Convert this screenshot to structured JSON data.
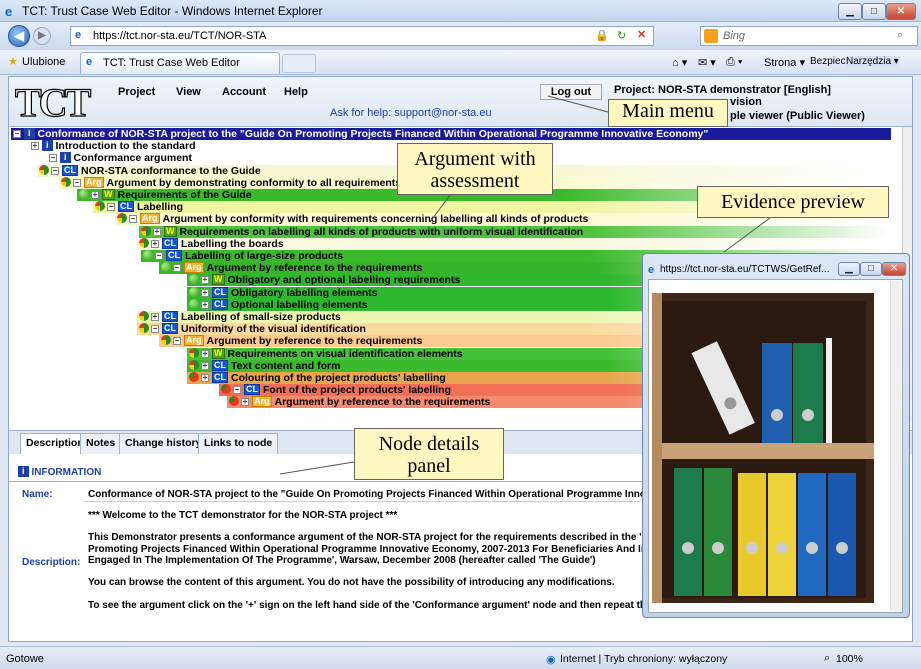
{
  "window": {
    "title": "TCT: Trust Case Web Editor - Windows Internet Explorer"
  },
  "browser": {
    "url": "https://tct.nor-sta.eu/TCT/NOR-STA",
    "search_placeholder": "Bing",
    "favorites": "Ulubione",
    "tab_title": "TCT: Trust Case Web Editor",
    "cmd_page": "Strona ▾",
    "cmd_safety": "Bezpieczeństwo ▾",
    "cmd_tools": "Narzędzia ▾"
  },
  "app": {
    "logo": "TCT",
    "menu": [
      "Project",
      "View",
      "Account",
      "Help"
    ],
    "logout": "Log out",
    "help_text": "Ask for help: support@nor-sta.eu",
    "project_line": "Project:  NOR-STA demonstrator [English]",
    "revision_fragment": "vision",
    "viewer_fragment": "ple viewer (Public Viewer)"
  },
  "tree": [
    {
      "text": "Conformance of NOR-STA project to the \"Guide On Promoting Projects Financed Within Operational Programme Innovative Economy\"",
      "icon": "I",
      "status": "none",
      "bg": "#1a1a9c",
      "fg": "#ffffff"
    },
    {
      "text": "Introduction to the standard",
      "icon": "I",
      "status": "none"
    },
    {
      "text": "Conformance argument",
      "icon": "I",
      "status": "none"
    },
    {
      "text": "NOR-STA conformance to the Guide",
      "icon": "CL",
      "status": "tri"
    },
    {
      "text": "Argument by demonstrating conformity to all requirements",
      "icon": "Arg",
      "status": "tri"
    },
    {
      "text": "Requirements of the Guide",
      "icon": "W",
      "status": "g"
    },
    {
      "text": "Labelling",
      "icon": "CL",
      "status": "tri"
    },
    {
      "text": "Argument by conformity with requirements concerning labelling all kinds of products",
      "icon": "Arg",
      "status": "tri"
    },
    {
      "text": "Requirements on labelling all kinds of products with uniform visual identification",
      "icon": "W",
      "status": "tri"
    },
    {
      "text": "Labelling the boards",
      "icon": "CL",
      "status": "tri"
    },
    {
      "text": "Labelling of large-size products",
      "icon": "CL",
      "status": "g"
    },
    {
      "text": "Argument by reference to the requirements",
      "icon": "Arg",
      "status": "g"
    },
    {
      "text": "Obligatory and optional labelling requirements",
      "icon": "W",
      "status": "g"
    },
    {
      "text": "Obligatory labelling elements",
      "icon": "CL",
      "status": "g"
    },
    {
      "text": "Optional labelling elements",
      "icon": "CL",
      "status": "g"
    },
    {
      "text": "Labelling of small-size products",
      "icon": "CL",
      "status": "tri"
    },
    {
      "text": "Uniformity of the visual identification",
      "icon": "CL",
      "status": "tri"
    },
    {
      "text": "Argument by reference to the requirements",
      "icon": "Arg",
      "status": "tri"
    },
    {
      "text": "Requirements on visual identification elements",
      "icon": "W",
      "status": "tri"
    },
    {
      "text": "Text content and form",
      "icon": "CL",
      "status": "tri"
    },
    {
      "text": "Colouring of the project products' labelling",
      "icon": "CL",
      "status": "rd"
    },
    {
      "text": "Font of the project products' labelling",
      "icon": "CL",
      "status": "rd"
    },
    {
      "text": "Argument by reference to the requirements",
      "icon": "Arg",
      "status": "rd"
    }
  ],
  "details": {
    "tabs": [
      "Description",
      "Notes",
      "Change history",
      "Links to node"
    ],
    "info_header": "INFORMATION",
    "name_label": "Name:",
    "name_value": "Conformance of NOR-STA project to the \"Guide On Promoting Projects Financed Within Operational Programme Innovative E",
    "desc_label": "Description:",
    "desc_lines": [
      "*** Welcome to the TCT demonstrator for the NOR-STA project ***",
      "",
      "This Demonstrator presents a conformance argument of the NOR-STA project for the requirements described in the 'Guide O",
      "Promoting Projects Financed Within Operational Programme Innovative Economy, 2007-2013 For Beneficiaries And Institutio",
      "Engaged In The Implementation Of The Programme', Warsaw, December 2008 (hereafter called 'The Guide')",
      "",
      "You can  browse the content of this argument. You do not have the possibility of introducing any modifications.",
      "",
      "To see the argument click on the '+' sign on the left hand side of the 'Conformance argument' node and then repeat this ac"
    ]
  },
  "evidence": {
    "url": "https://tct.nor-sta.eu/TCTWS/GetRef..."
  },
  "callouts": {
    "main_menu": "Main menu",
    "argument": "Argument with assessment",
    "evidence": "Evidence preview",
    "node_details": "Node details panel"
  },
  "status": {
    "left": "Gotowe",
    "zone": "Internet | Tryb chroniony: wyłączony",
    "zoom": "100%"
  }
}
